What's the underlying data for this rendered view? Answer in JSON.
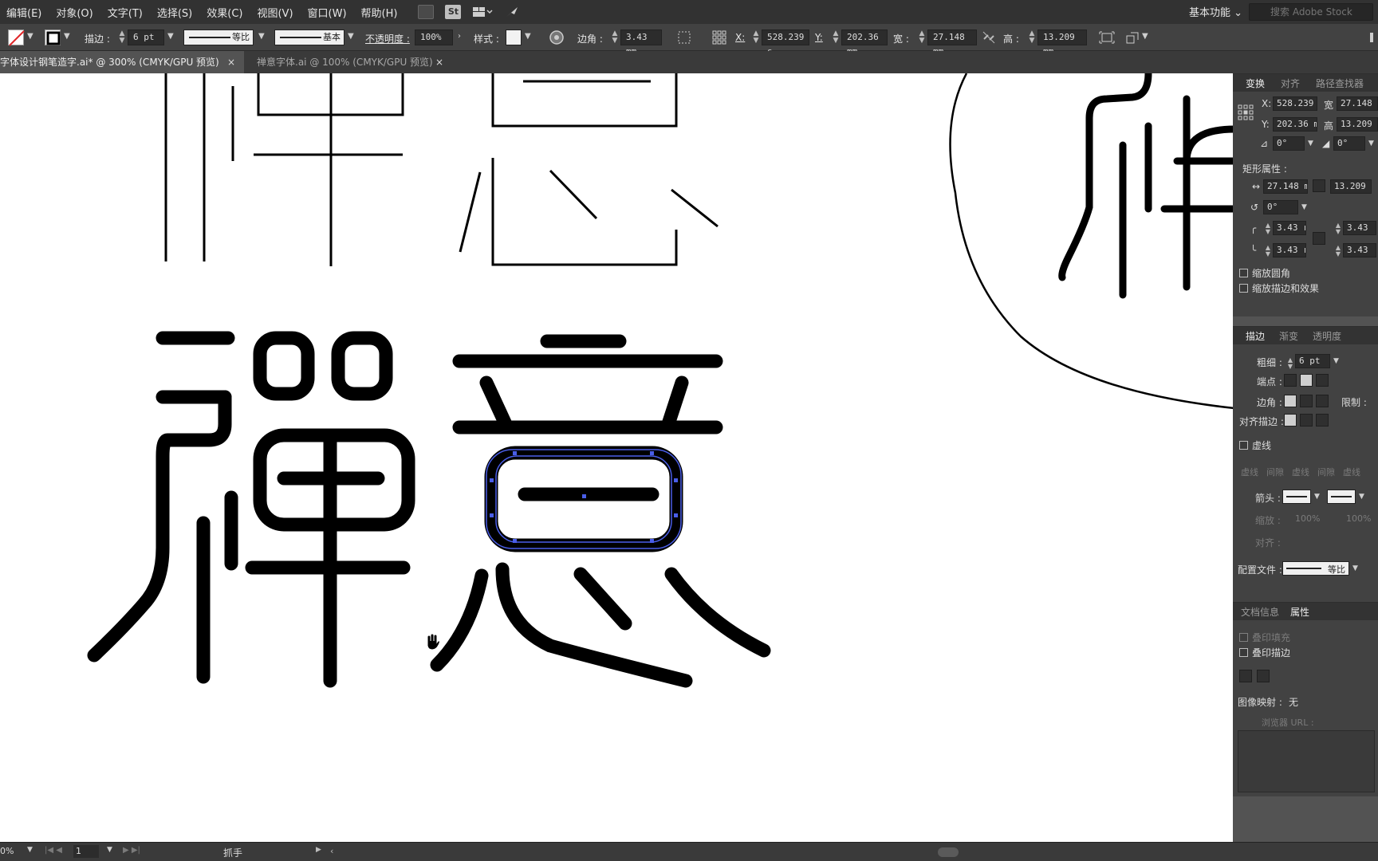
{
  "menu": [
    "编辑(E)",
    "对象(O)",
    "文字(T)",
    "选择(S)",
    "效果(C)",
    "视图(V)",
    "窗口(W)",
    "帮助(H)"
  ],
  "toolbar_icons": [
    "bridge-icon",
    "stock-icon",
    "arrange-documents-icon",
    "gpu-rocket-icon"
  ],
  "stock_badge": "St",
  "workspace": "基本功能",
  "search_placeholder": "搜索 Adobe Stock",
  "control": {
    "stroke_label": "描边 :",
    "stroke_weight": "6 pt",
    "profile_uniform": "等比",
    "brush_basic": "基本",
    "opacity_label": "不透明度 :",
    "opacity_value": "100%",
    "style_label": "样式 :",
    "corner_label": "边角 :",
    "corner_value": "3.43 mm",
    "x_label": "X:",
    "x_value": "528.239 s",
    "y_label": "Y:",
    "y_value": "202.36 mm",
    "w_label": "宽 :",
    "w_value": "27.148 mm",
    "h_label": "高 :",
    "h_value": "13.209 mm"
  },
  "tabs": [
    {
      "label": "字体设计钢笔造字.ai* @ 300% (CMYK/GPU 预览)",
      "active": true
    },
    {
      "label": "禅意字体.ai @ 100% (CMYK/GPU 预览)",
      "active": false
    }
  ],
  "tab_close": "×",
  "transform_panel": {
    "tabs": [
      "变换",
      "对齐",
      "路径查找器"
    ],
    "x_label": "X:",
    "x_value": "528.239 r",
    "w_label": "宽",
    "w_value": "27.148",
    "y_label": "Y:",
    "y_value": "202.36 mr",
    "h_label": "高",
    "h_value": "13.209",
    "angle_value": "0°",
    "shear_value": "0°",
    "rect_props_label": "矩形属性 :",
    "rect_w": "27.148 mr",
    "rect_h": "13.209",
    "rotate_value": "0°",
    "corner_tl": "3.43 r",
    "corner_tr": "3.43",
    "corner_bl": "3.43 r",
    "corner_br": "3.43",
    "scale_corners": "缩放圆角",
    "scale_strokes": "缩放描边和效果"
  },
  "stroke_panel": {
    "tabs": [
      "描边",
      "渐变",
      "透明度"
    ],
    "weight_label": "粗细 :",
    "weight_value": "6 pt",
    "cap_label": "端点 :",
    "corner_label": "边角 :",
    "limit_label": "限制 :",
    "align_label": "对齐描边 :",
    "dashed_label": "虚线",
    "dash_labels": [
      "虚线",
      "间隙",
      "虚线",
      "间隙",
      "虚线"
    ],
    "arrows_label": "箭头 :",
    "scale_label": "缩放 :",
    "scale_start": "100%",
    "scale_end": "100%",
    "align_arrow_label": "对齐 :",
    "profile_label": "配置文件 :",
    "profile_value": "等比"
  },
  "attributes_panel": {
    "tabs": [
      "文档信息",
      "属性"
    ],
    "overprint_fill": "叠印填充",
    "overprint_stroke": "叠印描边",
    "image_map_label": "图像映射 :",
    "image_map_value": "无",
    "browser_label": "浏览器 URL :"
  },
  "status": {
    "zoom": "0%",
    "page": "1",
    "tool": "抓手"
  },
  "colors": {
    "ui_dark": "#323232",
    "ui_mid": "#424242",
    "ui_bg": "#535353",
    "canvas": "#ffffff",
    "selection": "#4a5ee8",
    "artwork": "#000000"
  }
}
